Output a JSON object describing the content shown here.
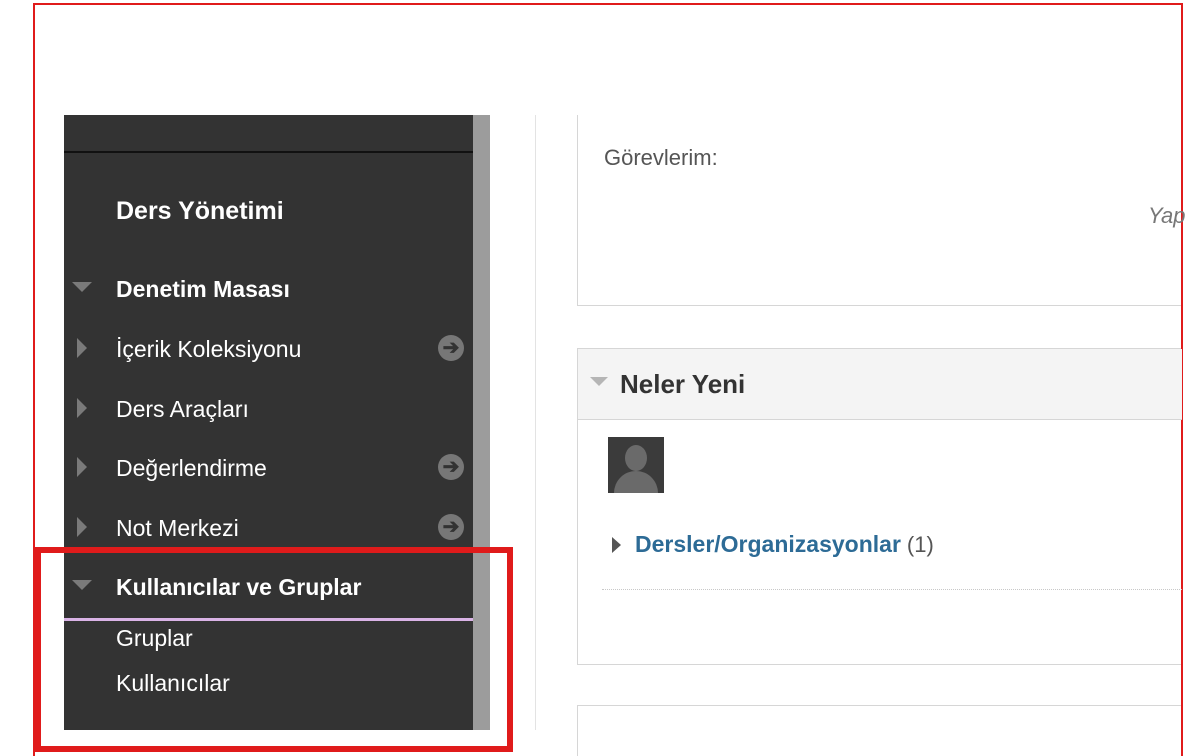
{
  "sidebar": {
    "heading": "Ders Yönetimi",
    "items": [
      {
        "label": "Denetim Masası",
        "expanded": true,
        "bold": true,
        "icon": "triangle-down-icon"
      },
      {
        "label": "İçerik Koleksiyonu",
        "expanded": false,
        "icon": "triangle-right-icon",
        "action_icon": "arrow-right-circle-icon"
      },
      {
        "label": "Ders Araçları",
        "expanded": false,
        "icon": "triangle-right-icon"
      },
      {
        "label": "Değerlendirme",
        "expanded": false,
        "icon": "triangle-right-icon",
        "action_icon": "arrow-right-circle-icon"
      },
      {
        "label": "Not Merkezi",
        "expanded": false,
        "icon": "triangle-right-icon",
        "action_icon": "arrow-right-circle-icon"
      },
      {
        "label": "Kullanıcılar ve Gruplar",
        "expanded": true,
        "bold": true,
        "icon": "triangle-down-icon"
      }
    ],
    "subitems": [
      "Gruplar",
      "Kullanıcılar"
    ]
  },
  "tasks": {
    "label": "Görevlerim:",
    "italic_text": "Yap"
  },
  "whats_new": {
    "title": "Neler Yeni",
    "link": "Dersler/Organizasyonlar",
    "count": "(1)"
  },
  "colors": {
    "highlight": "#e01b1b",
    "sidebar_bg": "#333333",
    "link": "#2d6b96",
    "submenu_underline": "#d9b3e6"
  }
}
